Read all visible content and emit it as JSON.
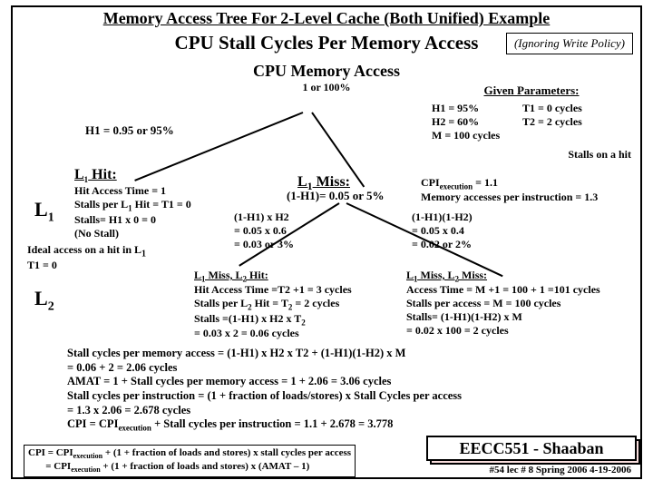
{
  "title": "Memory Access Tree For 2-Level Cache (Both Unified) Example",
  "subtitle": "CPU  Stall Cycles Per Memory Access",
  "ignore": "(Ignoring Write Policy)",
  "cpu_mem": "CPU Memory  Access",
  "hundred": "1 or 100%",
  "h1line": "H1 = 0.95 or 95%",
  "given": {
    "title": "Given Parameters:",
    "h1": "H1  = 95%",
    "t1": "T1  = 0 cycles",
    "h2": "H2  = 60%",
    "t2": "T2 = 2 cycles",
    "m": "M = 100 cycles",
    "stallshit": "Stalls on a hit",
    "cpi_exec": "CPIexecution = 1.1",
    "mem_instr": "Memory accesses per instruction = 1.3"
  },
  "l1label": "L1",
  "l2label": "L2",
  "l1hit": {
    "h": "L1 Hit:",
    "l1": "Hit Access Time = 1",
    "l2": "Stalls per L1 Hit = T1 = 0",
    "l3": "Stalls= H1 x 0 = 0",
    "l4": "(No Stall)"
  },
  "l1miss": {
    "h": "L1 Miss:",
    "p": "(1-H1)= 0.05 or  5%"
  },
  "calc1": {
    "a": "(1-H1) x H2",
    "b": "= 0.05 x 0.6",
    "c": "= 0.03 or 3%"
  },
  "calc2": {
    "a": "(1-H1)(1-H2)",
    "b": "= 0.05 x 0.4",
    "c": "=  0.02 or 2%"
  },
  "ideal": {
    "a": "Ideal access on a hit in L1",
    "b": "T1 = 0"
  },
  "l2hit": {
    "h": "L1 Miss, L2 Hit:",
    "a": "Hit Access Time =T2 +1 = 3 cycles",
    "b": "Stalls per L2 Hit = T2 = 2 cycles",
    "c": "Stalls =(1-H1) x H2 x T2",
    "d": "           =  0.03 x 2 = 0.06 cycles"
  },
  "l2miss": {
    "h": "L1 Miss, L2  Miss:",
    "a": "Access Time = M +1 = 100 + 1 =101 cycles",
    "b": "Stalls per access = M  = 100 cycles",
    "c": "Stalls=  (1-H1)(1-H2) x M",
    "d": "          =  0.02 x 100 = 2 cycles"
  },
  "summary": {
    "l1": "Stall cycles per memory access   =    (1-H1) x H2 x T2    +   (1-H1)(1-H2) x M",
    "l2": "                                                        =           0.06                  +  2          =  2.06 cycles",
    "l3": "AMAT  =   1  + Stall cycles per memory access  = 1 + 2.06  = 3.06 cycles",
    "l4": "Stall cycles per instruction =  (1  + fraction of loads/stores) x Stall Cycles per access",
    "l5": "                                                = 1.3 x  2.06  =  2.678 cycles",
    "l6": "CPI = CPIexecution  +  Stall cycles per instruction    =   1.1 + 2.678 =  3.778"
  },
  "cpi_box": {
    "a": "CPI = CPIexecution  +  (1 + fraction of loads and stores) x stall cycles per access",
    "b": "       = CPIexecution  +  (1 + fraction of loads and stores) x (AMAT – 1)"
  },
  "eecc": "EECC551 - Shaaban",
  "lecinfo": "#54  lec # 8    Spring 2006  4-19-2006"
}
